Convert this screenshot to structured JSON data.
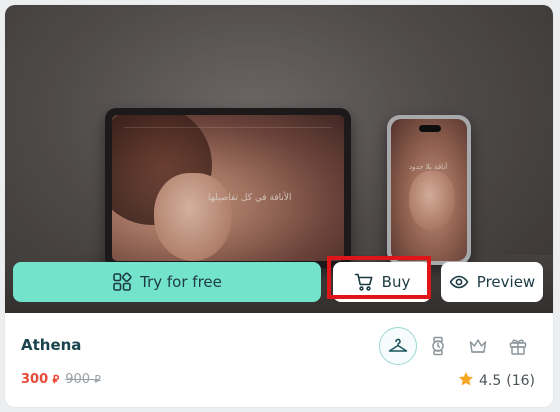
{
  "product": {
    "name": "Athena",
    "price": "300",
    "old_price": "900",
    "currency_symbol": "⃁",
    "rating": "4.5",
    "reviews": "(16)"
  },
  "actions": {
    "try_label": "Try for free",
    "buy_label": "Buy",
    "preview_label": "Preview"
  },
  "preview_screen": {
    "tablet_text": "الأناقة في كل تفاصيلها",
    "phone_text": "أناقة بلا حدود"
  },
  "categories": [
    {
      "icon": "hanger-icon",
      "active": true
    },
    {
      "icon": "watch-icon",
      "active": false
    },
    {
      "icon": "crown-icon",
      "active": false
    },
    {
      "icon": "gift-icon",
      "active": false
    }
  ],
  "colors": {
    "accent": "#74e3cb",
    "price": "#e84a3a",
    "title": "#19434d",
    "highlight": "#e0151a",
    "star": "#f5a623"
  }
}
